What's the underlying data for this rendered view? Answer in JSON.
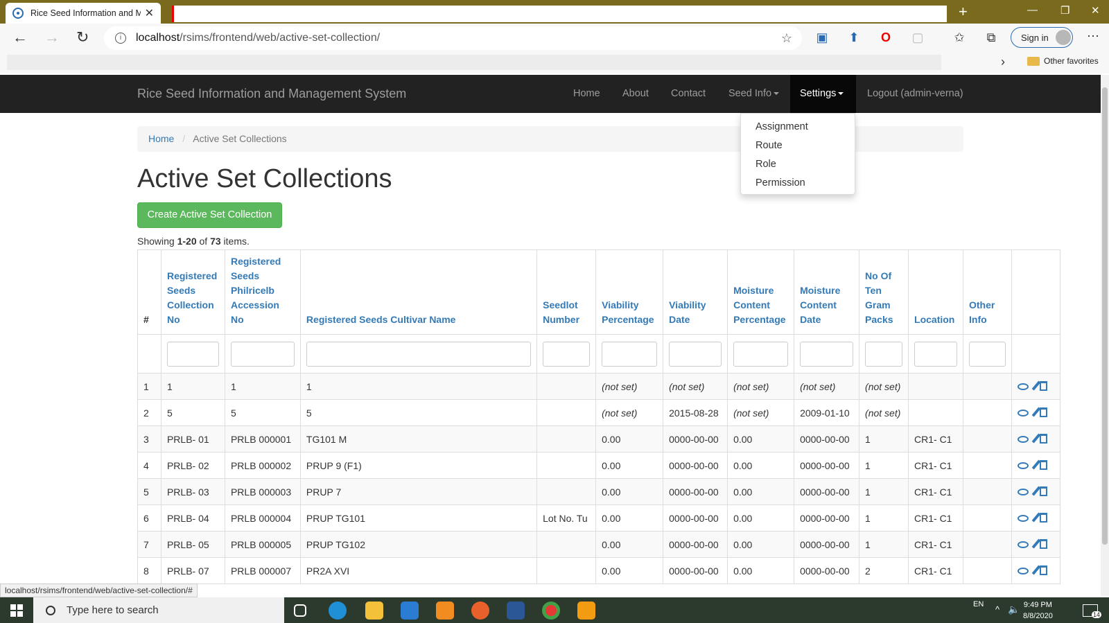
{
  "browser": {
    "tab_title": "Rice Seed Information and M",
    "url_host": "localhost",
    "url_path": "/rsims/frontend/web/active-set-collection/",
    "sign_in": "Sign in",
    "other_favorites": "Other favorites",
    "status_url": "localhost/rsims/frontend/web/active-set-collection/#"
  },
  "navbar": {
    "brand": "Rice Seed Information and Management System",
    "home": "Home",
    "about": "About",
    "contact": "Contact",
    "seed_info": "Seed Info",
    "settings": "Settings",
    "logout": "Logout (admin-verna)"
  },
  "settings_menu": {
    "items": [
      "Assignment",
      "Route",
      "Role",
      "Permission"
    ]
  },
  "breadcrumb": {
    "home": "Home",
    "current": "Active Set Collections"
  },
  "page": {
    "title": "Active Set Collections",
    "create_button": "Create Active Set Collection",
    "summary_prefix": "Showing ",
    "summary_range": "1-20",
    "summary_of": " of ",
    "summary_total": "73",
    "summary_suffix": " items."
  },
  "table": {
    "columns": [
      "#",
      "Registered Seeds Collection No",
      "Registered Seeds Philricelb Accession No",
      "Registered Seeds Cultivar Name",
      "Seedlot Number",
      "Viability Percentage",
      "Viability Date",
      "Moisture Content Percentage",
      "Moisture Content Date",
      "No Of Ten Gram Packs",
      "Location",
      "Other Info"
    ],
    "rows": [
      [
        "1",
        "1",
        "1",
        "1",
        "",
        "(not set)",
        "(not set)",
        "(not set)",
        "(not set)",
        "(not set)",
        "",
        ""
      ],
      [
        "2",
        "5",
        "5",
        "5",
        "",
        "(not set)",
        "2015-08-28",
        "(not set)",
        "2009-01-10",
        "(not set)",
        "",
        ""
      ],
      [
        "3",
        "PRLB- 01",
        "PRLB 000001",
        "TG101 M",
        "",
        "0.00",
        "0000-00-00",
        "0.00",
        "0000-00-00",
        "1",
        "CR1- C1",
        ""
      ],
      [
        "4",
        "PRLB- 02",
        "PRLB 000002",
        "PRUP 9 (F1)",
        "",
        "0.00",
        "0000-00-00",
        "0.00",
        "0000-00-00",
        "1",
        "CR1- C1",
        ""
      ],
      [
        "5",
        "PRLB- 03",
        "PRLB 000003",
        "PRUP 7",
        "",
        "0.00",
        "0000-00-00",
        "0.00",
        "0000-00-00",
        "1",
        "CR1- C1",
        ""
      ],
      [
        "6",
        "PRLB- 04",
        "PRLB 000004",
        "PRUP TG101",
        "Lot No. Tu",
        "0.00",
        "0000-00-00",
        "0.00",
        "0000-00-00",
        "1",
        "CR1- C1",
        ""
      ],
      [
        "7",
        "PRLB- 05",
        "PRLB 000005",
        "PRUP TG102",
        "",
        "0.00",
        "0000-00-00",
        "0.00",
        "0000-00-00",
        "1",
        "CR1- C1",
        ""
      ],
      [
        "8",
        "PRLB- 07",
        "PRLB 000007",
        "PR2A XVI",
        "",
        "0.00",
        "0000-00-00",
        "0.00",
        "0000-00-00",
        "2",
        "CR1- C1",
        ""
      ]
    ]
  },
  "taskbar": {
    "search_placeholder": "Type here to search",
    "lang": "EN",
    "time": "9:49 PM",
    "date": "8/8/2020",
    "notifications": "14"
  },
  "colors": {
    "navbar_bg": "#222222",
    "link": "#337ab7",
    "create_button": "#5cb85c",
    "not_set": "#cc5555"
  }
}
